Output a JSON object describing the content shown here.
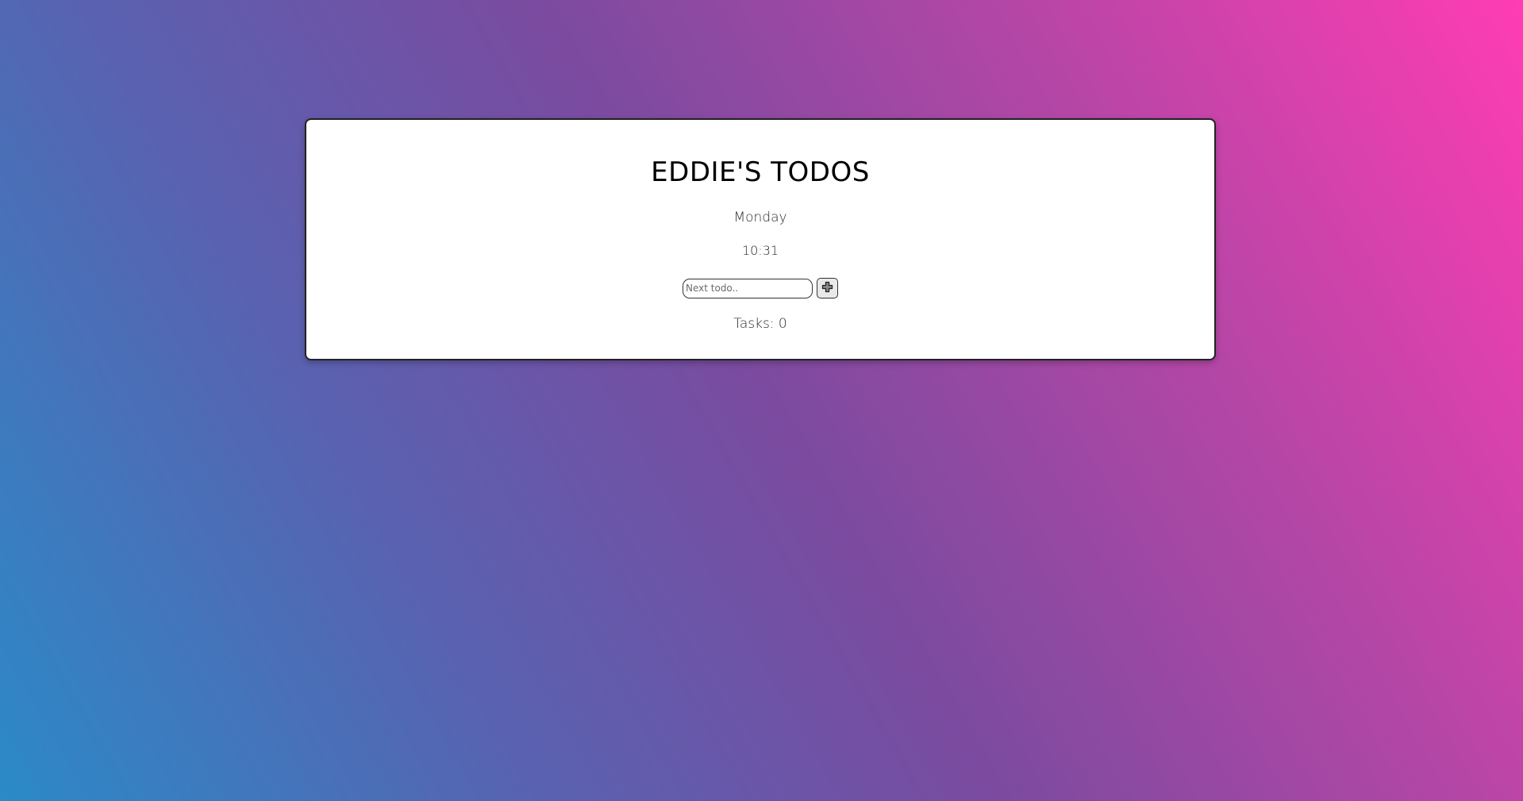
{
  "app": {
    "title": "EDDIE'S TODOS",
    "day": "Monday",
    "time": "10:31"
  },
  "form": {
    "input_placeholder": "Next todo..",
    "input_value": "",
    "add_icon": "plus-icon"
  },
  "tasks": {
    "label": "Tasks: 0"
  },
  "colors": {
    "gradient_start": "#2b8ac7",
    "gradient_mid": "#7a4ba0",
    "gradient_end": "#ff3cb3",
    "card_background": "#ffffff"
  }
}
